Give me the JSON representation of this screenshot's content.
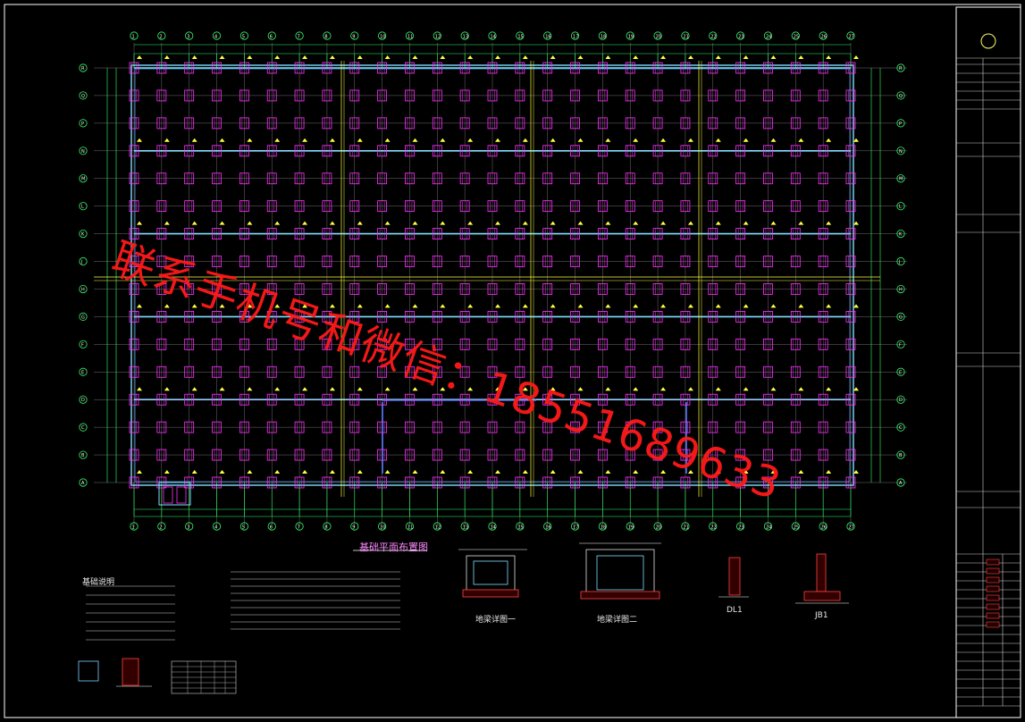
{
  "watermark_text": "联系手机号和微信：18551689633",
  "drawing": {
    "plan_title": "基础平面布置图",
    "grid_columns": [
      "1",
      "2",
      "3",
      "4",
      "5",
      "6",
      "7",
      "8",
      "9",
      "10",
      "11",
      "12",
      "13",
      "14",
      "15",
      "16",
      "17",
      "18",
      "19",
      "20",
      "21",
      "22",
      "23",
      "24",
      "25",
      "26",
      "27"
    ],
    "grid_rows": [
      "A",
      "B",
      "C",
      "D",
      "E",
      "F",
      "G",
      "H",
      "J",
      "K",
      "L",
      "M",
      "N",
      "P",
      "Q",
      "R"
    ],
    "detail_labels": [
      "地梁详图一",
      "地梁详图二",
      "DL1",
      "JB1"
    ],
    "notes_title": "基础说明"
  },
  "colors": {
    "background": "#000000",
    "frame": "#ffffff",
    "beam": "#7fdfff",
    "pile": "#ff33ff",
    "axis": "#33ff66",
    "yellow": "#ffff44",
    "watermark": "#ff1a1a"
  }
}
